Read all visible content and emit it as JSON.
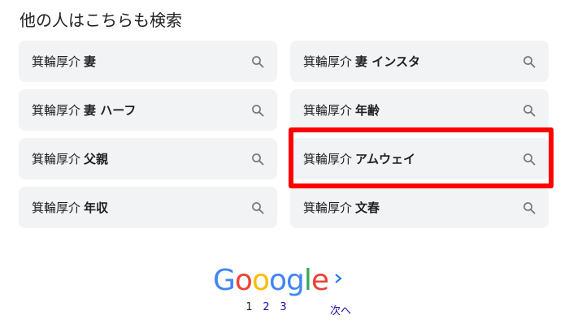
{
  "section": {
    "heading": "他の人はこちらも検索"
  },
  "related_searches": [
    {
      "base": "箕輪厚介",
      "suffix": "妻"
    },
    {
      "base": "箕輪厚介",
      "suffix": "妻 インスタ"
    },
    {
      "base": "箕輪厚介",
      "suffix": "妻 ハーフ"
    },
    {
      "base": "箕輪厚介",
      "suffix": "年齢"
    },
    {
      "base": "箕輪厚介",
      "suffix": "父親"
    },
    {
      "base": "箕輪厚介",
      "suffix": "アムウェイ"
    },
    {
      "base": "箕輪厚介",
      "suffix": "年収"
    },
    {
      "base": "箕輪厚介",
      "suffix": "文春"
    }
  ],
  "pagination": {
    "logo_letters": [
      "G",
      "o",
      "o",
      "o",
      "g",
      "l",
      "e"
    ],
    "logo_colors": [
      "#4285f4",
      "#ea4335",
      "#fbbc05",
      "#4285f4",
      "#4285f4",
      "#34a853",
      "#ea4335"
    ],
    "pages": [
      "1",
      "2",
      "3"
    ],
    "current": "1",
    "next_label": "次へ"
  },
  "colors": {
    "chip_bg": "#f1f3f4",
    "highlight": "#ff0000",
    "link": "#1a0dab"
  },
  "icons": {
    "chip_icon": "search-icon",
    "next": "chevron-right-icon"
  }
}
